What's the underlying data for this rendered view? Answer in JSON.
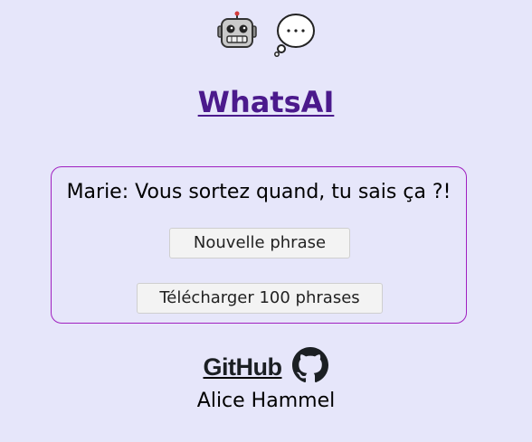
{
  "header": {
    "icons": [
      "robot-face-icon",
      "thought-balloon-icon"
    ],
    "title": "WhatsAI"
  },
  "generator": {
    "phrase": "Marie: Vous sortez quand, tu sais ça ?!",
    "new_phrase_label": "Nouvelle phrase",
    "download_label": "Télécharger 100 phrases"
  },
  "footer": {
    "github_label": "GitHub",
    "author": "Alice Hammel"
  },
  "colors": {
    "background": "#e6e6fa",
    "title": "#4b1a8c",
    "card_border": "#a020c0"
  }
}
